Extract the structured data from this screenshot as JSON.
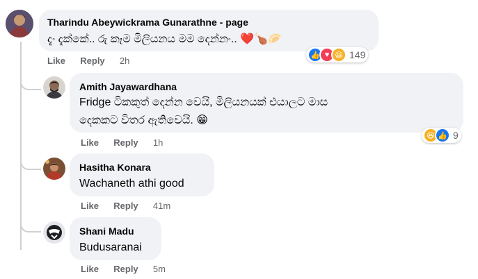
{
  "comments": [
    {
      "author": "Tharindu Abeywickrama Gunarathne - page",
      "text": "දැං දැක්කේ.. රු කෑම මිලියනය මම දෙන්නං..",
      "emoji": "❤️🍗🥟",
      "actions": {
        "like": "Like",
        "reply": "Reply",
        "time": "2h"
      },
      "reactions": {
        "icons": [
          "like-icon",
          "love-icon",
          "haha-icon"
        ],
        "count": "149"
      },
      "colors": {
        "like": "#1877f2",
        "love": "#f33e58",
        "haha": "#f7b125"
      }
    },
    {
      "author": "Amith Jayawardhana",
      "text_line1": "Fridge ටිකකුත් දෙන්න වෙයි, මිලියනයක් එයාලට මාස",
      "text_line2": "දෙකකට විතර ඇතිවෙයි.",
      "emoji": "😁",
      "actions": {
        "like": "Like",
        "reply": "Reply",
        "time": "1h"
      },
      "reactions": {
        "icons": [
          "haha-icon",
          "like-icon"
        ],
        "count": "9"
      }
    },
    {
      "author": "Hasitha Konara",
      "text": "Wachaneth athi good",
      "actions": {
        "like": "Like",
        "reply": "Reply",
        "time": "41m"
      }
    },
    {
      "author": "Shani Madu",
      "text": "Budusaranai",
      "actions": {
        "like": "Like",
        "reply": "Reply",
        "time": "5m"
      }
    }
  ]
}
